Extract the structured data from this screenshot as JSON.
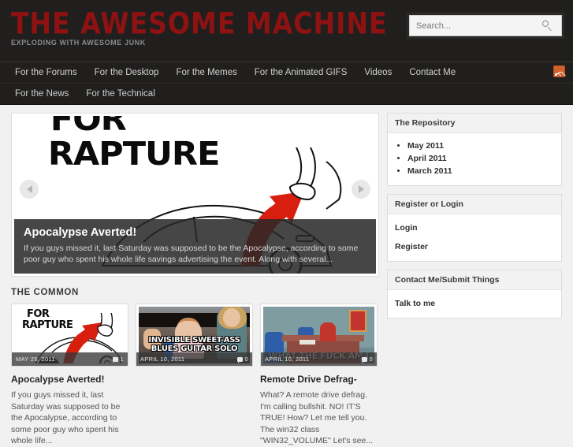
{
  "header": {
    "site_title": "THE AWESOME MACHINE",
    "tagline": "EXPLODING WITH AWESOME JUNK",
    "search": {
      "placeholder": "Search...",
      "value": "",
      "icon": "search-icon"
    },
    "rss_icon": "rss-icon"
  },
  "nav": {
    "row1": [
      {
        "label": "For the Forums"
      },
      {
        "label": "For the Desktop"
      },
      {
        "label": "For the Memes"
      },
      {
        "label": "For the Animated GIFS"
      },
      {
        "label": "Videos"
      },
      {
        "label": "Contact Me"
      }
    ],
    "row2": [
      {
        "label": "For the News"
      },
      {
        "label": "For the Technical"
      }
    ]
  },
  "slider": {
    "prev_icon": "chevron-left-icon",
    "next_icon": "chevron-right-icon",
    "image_text_line1": "FOR",
    "image_text_line2": "RAPTURE",
    "caption_title": "Apocalypse Averted!",
    "caption_text": "If you guys missed it, last Saturday was supposed to be the Apocalypse, according to some poor guy who spent his whole life savings advertising the event.  Along with several..."
  },
  "section": {
    "heading": "THE COMMON"
  },
  "cards": [
    {
      "date": "MAY 25, 2011",
      "comments": "1",
      "thumb_line1": "FOR",
      "thumb_line2": "RAPTURE",
      "title": "Apocalypse Averted!",
      "excerpt": "If you guys missed it, last Saturday was supposed to be the Apocalypse, according to some poor guy who spent his whole life..."
    },
    {
      "date": "APRIL 10, 2011",
      "comments": "0",
      "meme_line1": "INVISIBLE SWEET-ASS",
      "meme_line2": "BLUES GUITAR SOLO",
      "title": "",
      "excerpt": ""
    },
    {
      "date": "APRIL 10, 2011",
      "comments": "0",
      "meme_line1": "WHAT THE FUCK AM I",
      "title": "Remote Drive Defrag-",
      "excerpt": "What?   A remote drive defrag.  I'm calling bullshit.  NO!  IT'S TRUE!  How?  Let me tell you.  The win32 class \"WIN32_VOLUME\" Let's see..."
    }
  ],
  "sidebar": {
    "widgets": [
      {
        "title": "The Repository",
        "items": [
          {
            "label": "May 2011"
          },
          {
            "label": "April 2011"
          },
          {
            "label": "March 2011"
          }
        ]
      },
      {
        "title": "Register or Login",
        "links": [
          {
            "label": "Login"
          },
          {
            "label": "Register"
          }
        ]
      },
      {
        "title": "Contact Me/Submit Things",
        "links": [
          {
            "label": "Talk to me"
          }
        ]
      }
    ]
  },
  "colors": {
    "header_bg": "#201f1e",
    "title_red": "#8f1212",
    "body_bg": "#f1f1f1",
    "rss_orange": "#d2622b",
    "accent_red": "#d81f0f"
  }
}
